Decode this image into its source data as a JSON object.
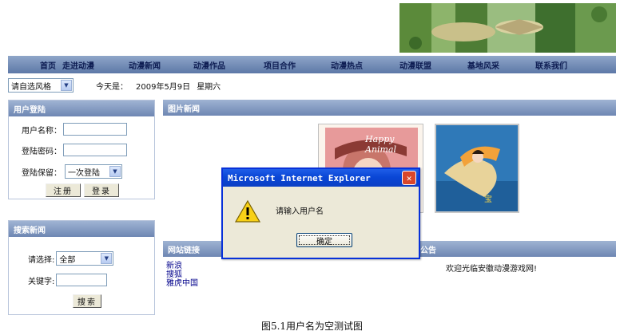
{
  "nav": {
    "items": [
      "首页",
      "走进动漫",
      "动漫新闻",
      "动漫作品",
      "项目合作",
      "动漫热点",
      "动漫联盟",
      "基地风采",
      "联系我们"
    ]
  },
  "style_row": {
    "style_select": "请自选风格",
    "today_label": "今天是：",
    "date": "2009年5月9日",
    "weekday": "星期六"
  },
  "login": {
    "title": "用户登陆",
    "username_label": "用户名称：",
    "password_label": "登陆密码：",
    "keep_label": "登陆保留：",
    "keep_value": "一次登陆",
    "register_button": "注册",
    "login_button": "登录"
  },
  "search": {
    "title": "搜索新闻",
    "select_label": "请选择:",
    "select_value": "全部",
    "keyword_label": "关键字:",
    "search_button": "搜索"
  },
  "pic_news": {
    "title": "图片新闻",
    "thumb1_text": "Happy Animal"
  },
  "links": {
    "title": "网站链接",
    "items": [
      "新浪",
      "搜狐",
      "雅虎中国"
    ]
  },
  "notice": {
    "title": "公告",
    "text": "欢迎光临安徽动漫游戏网!"
  },
  "dialog": {
    "title": "Microsoft Internet Explorer",
    "message": "请输入用户名",
    "ok_button": "确定"
  },
  "caption": "图5.1用户名为空测试图",
  "colors": {
    "nav_bar": "#6f89b5",
    "dialog_title": "#0a46d6",
    "close_button": "#d9472b"
  }
}
